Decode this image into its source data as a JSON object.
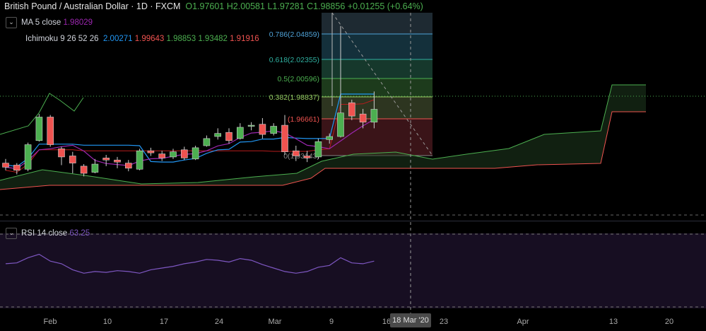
{
  "header": {
    "symbol": "British Pound / Australian Dollar · 1D · FXCM",
    "open": "O1.97601",
    "high": "H2.00581",
    "low": "L1.97281",
    "close": "C1.98856",
    "change": "+0.01255 (+0.64%)"
  },
  "indicators": {
    "ma": {
      "name": "MA 5 close",
      "value": "1.98029"
    },
    "ichimoku": {
      "name": "Ichimoku 9 26 52 26",
      "values": [
        "2.00271",
        "1.99643",
        "1.98853",
        "1.93482",
        "1.91916"
      ]
    },
    "rsi": {
      "name": "RSI 14 close",
      "value": "63.25"
    }
  },
  "fib_labels": [
    "0.786(2.04859)",
    "0.618(2.02355)",
    "0.5(2.00596)",
    "0.382(1.98837)",
    "(1.96661)",
    "0(1.93143)"
  ],
  "x_axis": {
    "labels": [
      "Feb",
      "10",
      "17",
      "24",
      "Mar",
      "9",
      "16",
      "23",
      "Apr",
      "13",
      "20"
    ],
    "crosshair": "18 Mar '20"
  },
  "colors": {
    "up": "#4caf50",
    "down": "#ef5350",
    "ma": "#9c27b0",
    "tenkan": "#2196f3",
    "kijun": "#b71c1c",
    "span_a": "#4caf50",
    "span_b": "#ef5350",
    "rsi": "#7e57c2"
  },
  "chart_data": {
    "type": "candlestick",
    "title": "British Pound / Australian Dollar · 1D · FXCM",
    "candles": [
      {
        "o": 1.936,
        "h": 1.94,
        "l": 1.929,
        "c": 1.932
      },
      {
        "o": 1.934,
        "h": 1.936,
        "l": 1.925,
        "c": 1.929
      },
      {
        "o": 1.93,
        "h": 1.956,
        "l": 1.928,
        "c": 1.954
      },
      {
        "o": 1.958,
        "h": 1.984,
        "l": 1.957,
        "c": 1.981
      },
      {
        "o": 1.981,
        "h": 1.983,
        "l": 1.952,
        "c": 1.954
      },
      {
        "o": 1.95,
        "h": 1.952,
        "l": 1.934,
        "c": 1.942
      },
      {
        "o": 1.943,
        "h": 1.947,
        "l": 1.926,
        "c": 1.936
      },
      {
        "o": 1.933,
        "h": 1.935,
        "l": 1.923,
        "c": 1.926
      },
      {
        "o": 1.927,
        "h": 1.94,
        "l": 1.926,
        "c": 1.935
      },
      {
        "o": 1.941,
        "h": 1.944,
        "l": 1.933,
        "c": 1.939
      },
      {
        "o": 1.939,
        "h": 1.942,
        "l": 1.931,
        "c": 1.937
      },
      {
        "o": 1.936,
        "h": 1.939,
        "l": 1.928,
        "c": 1.931
      },
      {
        "o": 1.93,
        "h": 1.95,
        "l": 1.929,
        "c": 1.948
      },
      {
        "o": 1.948,
        "h": 1.951,
        "l": 1.943,
        "c": 1.946
      },
      {
        "o": 1.945,
        "h": 1.948,
        "l": 1.938,
        "c": 1.941
      },
      {
        "o": 1.942,
        "h": 1.95,
        "l": 1.94,
        "c": 1.947
      },
      {
        "o": 1.949,
        "h": 1.952,
        "l": 1.939,
        "c": 1.941
      },
      {
        "o": 1.94,
        "h": 1.953,
        "l": 1.939,
        "c": 1.951
      },
      {
        "o": 1.953,
        "h": 1.963,
        "l": 1.952,
        "c": 1.96
      },
      {
        "o": 1.962,
        "h": 1.97,
        "l": 1.959,
        "c": 1.965
      },
      {
        "o": 1.966,
        "h": 1.97,
        "l": 1.955,
        "c": 1.958
      },
      {
        "o": 1.96,
        "h": 1.975,
        "l": 1.959,
        "c": 1.971
      },
      {
        "o": 1.972,
        "h": 1.976,
        "l": 1.968,
        "c": 1.973
      },
      {
        "o": 1.974,
        "h": 1.98,
        "l": 1.96,
        "c": 1.964
      },
      {
        "o": 1.965,
        "h": 1.975,
        "l": 1.963,
        "c": 1.972
      },
      {
        "o": 1.973,
        "h": 1.983,
        "l": 1.944,
        "c": 1.947
      },
      {
        "o": 1.948,
        "h": 1.953,
        "l": 1.938,
        "c": 1.943
      },
      {
        "o": 1.943,
        "h": 1.948,
        "l": 1.937,
        "c": 1.941
      },
      {
        "o": 1.942,
        "h": 1.96,
        "l": 1.94,
        "c": 1.957
      },
      {
        "o": 1.959,
        "h": 1.965,
        "l": 1.955,
        "c": 1.962
      },
      {
        "o": 1.962,
        "h": 2.07,
        "l": 1.961,
        "c": 1.985
      },
      {
        "o": 1.995,
        "h": 1.998,
        "l": 1.978,
        "c": 1.982
      },
      {
        "o": 1.984,
        "h": 1.989,
        "l": 1.97,
        "c": 1.976
      },
      {
        "o": 1.976,
        "h": 2.006,
        "l": 1.97,
        "c": 1.9886
      }
    ],
    "ylim": [
      1.888,
      2.083
    ],
    "rsi": [
      55,
      56,
      62,
      66,
      58,
      55,
      48,
      44,
      46,
      45,
      47,
      46,
      44,
      48,
      50,
      52,
      55,
      57,
      60,
      59,
      57,
      61,
      59,
      54,
      50,
      46,
      44,
      46,
      51,
      53,
      62,
      56,
      55,
      58
    ],
    "rsi_ylim": [
      0,
      100
    ]
  }
}
